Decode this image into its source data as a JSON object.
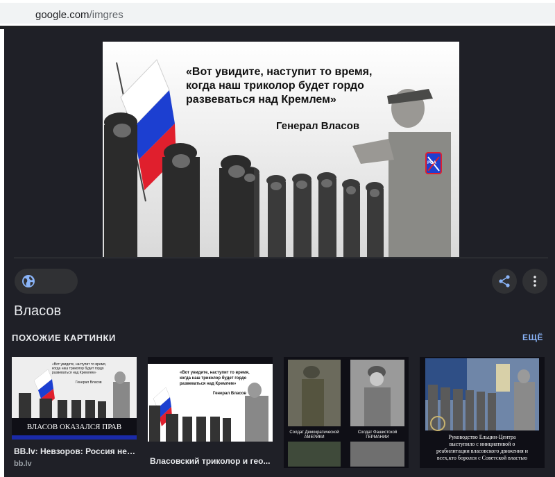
{
  "address_bar": {
    "domain": "google.com",
    "path": "/imgres"
  },
  "main_image": {
    "quote_line1": "«Вот увидите, наступит то время,",
    "quote_line2": "когда наш триколор будет гордо",
    "quote_line3": "развеваться над Кремлем»",
    "attribution": "Генерал Власов",
    "patch_label": "РОА"
  },
  "title": "Власов",
  "similar": {
    "heading": "ПОХОЖИЕ КАРТИНКИ",
    "more_label": "ЕЩЁ",
    "items": [
      {
        "caption": "BB.lv: Невзоров: Россия не ...",
        "source": "bb.lv",
        "overlay_text": "ВЛАСОВ ОКАЗАЛСЯ ПРАВ",
        "quote_line1": "«Вот увидите, наступит то время,",
        "quote_line2": "когда наш триколор будет гордо",
        "quote_line3": "развеваться над Кремлем»",
        "attribution": "Генерал Власов"
      },
      {
        "caption": "Власовский триколор и гео...",
        "source": "",
        "quote_line1": "«Вот увидите, наступит то время,",
        "quote_line2": "когда наш триколор будет гордо",
        "quote_line3": "развеваться над Кремлем»",
        "attribution": "Генерал Власов"
      },
      {
        "caption": "",
        "source": "",
        "label_left_1": "Солдат Демократической",
        "label_left_2": "АМЕРИКИ",
        "label_right_1": "Солдат Фашистской",
        "label_right_2": "ГЕРМАНИИ"
      },
      {
        "caption": "",
        "source": "",
        "text_line1": "Руководство Ельцин-Центра",
        "text_line2": "выступило с инициативой о",
        "text_line3": "реабилитации власовского движения и",
        "text_line4": "всех,кто боролся с Советской властью"
      }
    ]
  },
  "colors": {
    "panel_bg": "#1f2027",
    "chip_bg": "#303134",
    "accent_blue": "#8ab4f8",
    "text_primary": "#e8eaed",
    "flag_white": "#ffffff",
    "flag_blue": "#1c3fd1",
    "flag_red": "#e01f2d"
  },
  "icons": {
    "globe": "globe-icon",
    "share": "share-icon",
    "more": "more-vertical-icon"
  }
}
